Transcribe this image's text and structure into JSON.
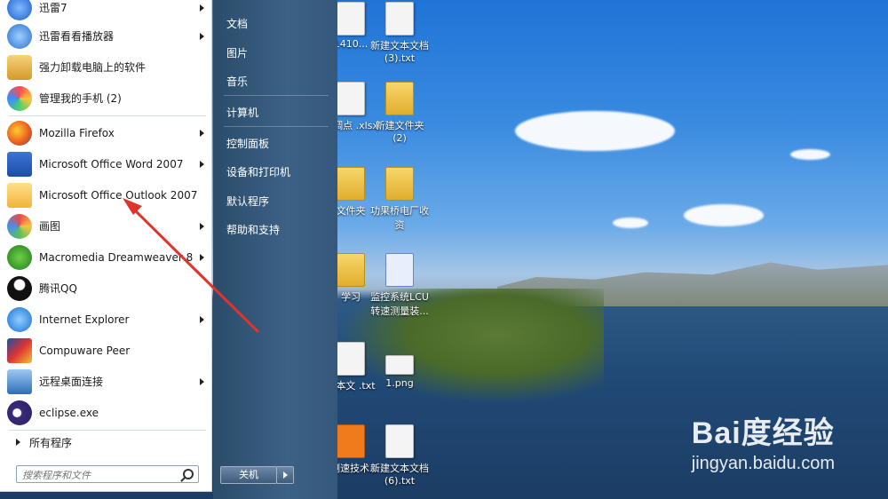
{
  "start_menu": {
    "programs": [
      {
        "label": "迅雷7",
        "icon": "xunlei-icon",
        "has_submenu": true
      },
      {
        "label": "迅雷看看播放器",
        "icon": "xunlei-player-icon",
        "has_submenu": true
      },
      {
        "label": "强力卸载电脑上的软件",
        "icon": "uninstall-icon",
        "has_submenu": false
      },
      {
        "label": "管理我的手机 (2)",
        "icon": "phone-manager-icon",
        "has_submenu": false
      },
      {
        "label": "Mozilla Firefox",
        "icon": "firefox-icon",
        "has_submenu": true
      },
      {
        "label": "Microsoft Office Word 2007",
        "icon": "word-icon",
        "has_submenu": true
      },
      {
        "label": "Microsoft Office Outlook 2007",
        "icon": "outlook-icon",
        "has_submenu": false
      },
      {
        "label": "画图",
        "icon": "paint-icon",
        "has_submenu": true
      },
      {
        "label": "Macromedia Dreamweaver 8",
        "icon": "dreamweaver-icon",
        "has_submenu": true
      },
      {
        "label": "腾讯QQ",
        "icon": "qq-icon",
        "has_submenu": false
      },
      {
        "label": "Internet Explorer",
        "icon": "ie-icon",
        "has_submenu": true
      },
      {
        "label": "Compuware Peer",
        "icon": "compuware-icon",
        "has_submenu": false
      },
      {
        "label": "远程桌面连接",
        "icon": "remote-desktop-icon",
        "has_submenu": true
      },
      {
        "label": "eclipse.exe",
        "icon": "eclipse-icon",
        "has_submenu": false
      }
    ],
    "all_programs": "所有程序",
    "search_placeholder": "搜索程序和文件",
    "right_items": [
      "文档",
      "图片",
      "音乐",
      "计算机",
      "控制面板",
      "设备和打印机",
      "默认程序",
      "帮助和支持"
    ],
    "shutdown": "关机"
  },
  "desktop_icons": [
    {
      "label": "1410...",
      "type": "doc"
    },
    {
      "label": "新建文本文档 (3).txt",
      "type": "doc"
    },
    {
      "label": "首调点 .xlsx",
      "type": "doc"
    },
    {
      "label": "新建文件夹 (2)",
      "type": "folder"
    },
    {
      "label": "文件夹",
      "type": "folder"
    },
    {
      "label": "功果桥电厂收资",
      "type": "folder"
    },
    {
      "label": "学习",
      "type": "folder"
    },
    {
      "label": "监控系统LCU转速测量装...",
      "type": "word"
    },
    {
      "label": "文本文 .txt",
      "type": "doc"
    },
    {
      "label": "1.png",
      "type": "image"
    },
    {
      "label": "D测速技术...",
      "type": "pdf"
    },
    {
      "label": "新建文本文档 (6).txt",
      "type": "doc"
    }
  ],
  "watermark": {
    "logo": "Bai度经验",
    "url": "jingyan.baidu.com"
  },
  "colors": {
    "menu_right_pane": "#3c6185",
    "annotation_arrow": "#e0332b"
  }
}
